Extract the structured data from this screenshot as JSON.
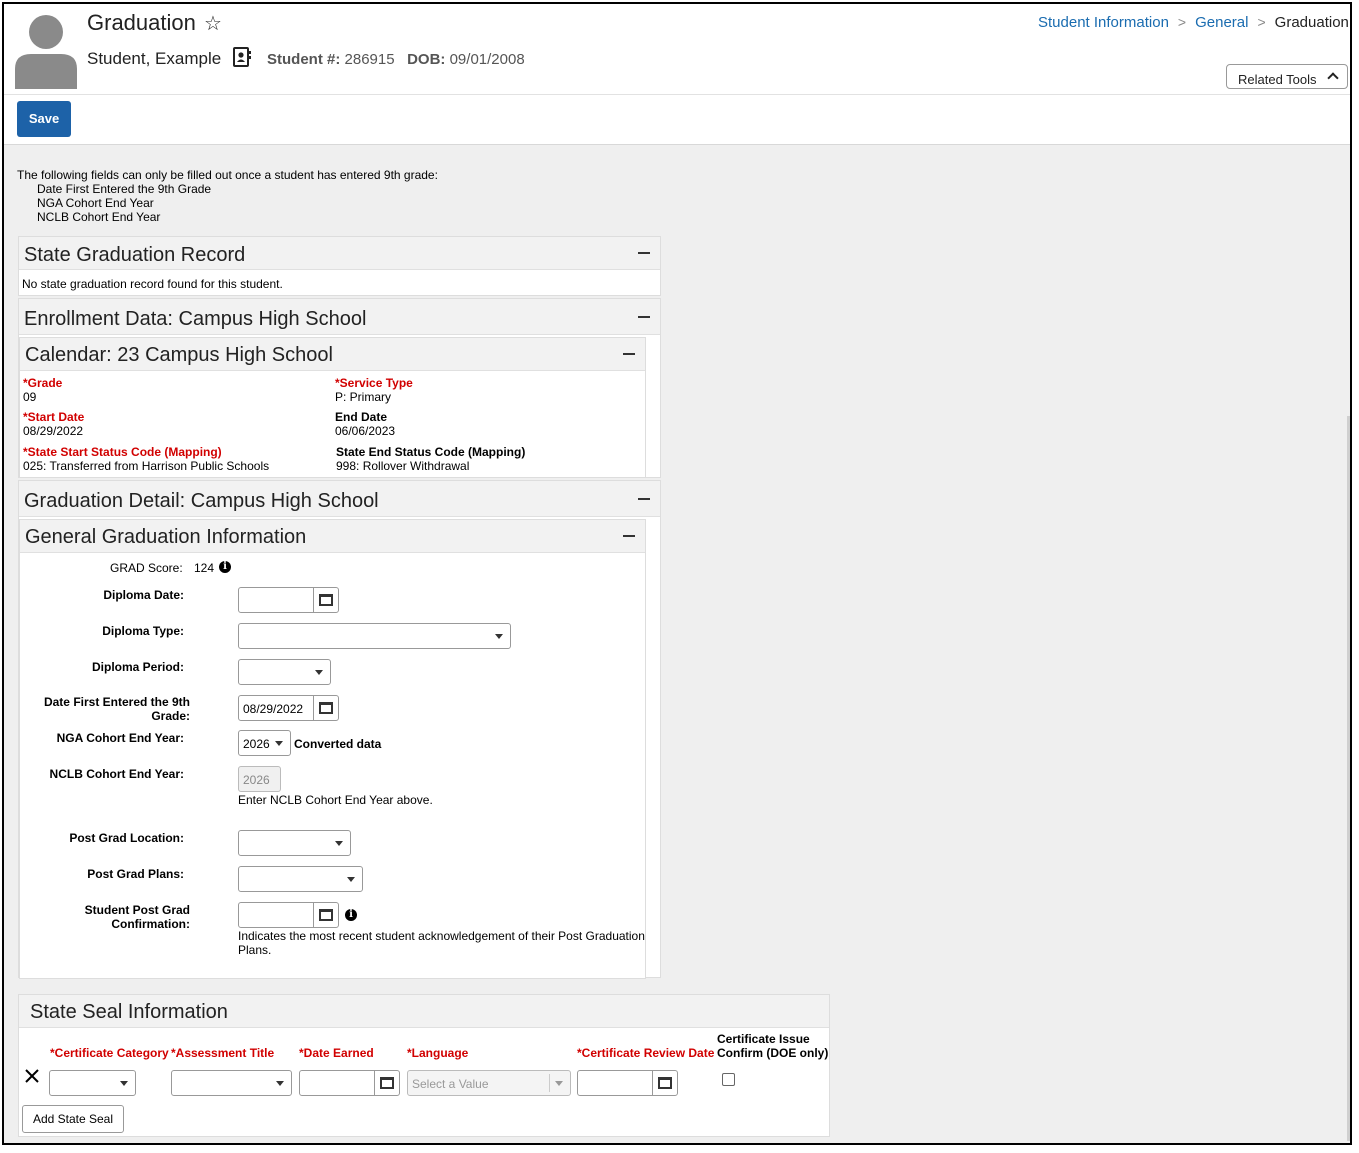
{
  "header": {
    "title": "Graduation",
    "student_name": "Student, Example",
    "student_num_label": "Student #:",
    "student_num": "286915",
    "dob_label": "DOB:",
    "dob": "09/01/2008"
  },
  "breadcrumb": [
    "Student Information",
    "General",
    "Graduation"
  ],
  "related_tools": "Related Tools",
  "toolbar": {
    "save": "Save"
  },
  "notice": {
    "intro": "The following fields can only be filled out once a student has entered 9th grade:",
    "items": [
      "Date First Entered the 9th Grade",
      "NGA Cohort End Year",
      "NCLB Cohort End Year"
    ]
  },
  "state_grad": {
    "title": "State Graduation Record",
    "message": "No state graduation record found for this student."
  },
  "enrollment": {
    "title": "Enrollment Data: Campus High School",
    "calendar": {
      "title": "Calendar: 23 Campus High School",
      "grade_label": "Grade",
      "grade": "09",
      "service_label": "Service Type",
      "service": "P: Primary",
      "start_label": "Start Date",
      "start": "08/29/2022",
      "end_label": "End Date",
      "end": "06/06/2023",
      "start_status_label": "State Start Status Code (Mapping)",
      "start_status": "025: Transferred from Harrison Public Schools",
      "end_status_label": "State End Status Code (Mapping)",
      "end_status": "998: Rollover Withdrawal"
    }
  },
  "grad_detail": {
    "title": "Graduation Detail: Campus High School",
    "general": {
      "title": "General Graduation Information",
      "grad_score_label": "GRAD Score:",
      "grad_score": "124",
      "diploma_date_label": "Diploma Date:",
      "diploma_type_label": "Diploma Type:",
      "diploma_period_label": "Diploma Period:",
      "first9_label_1": "Date First Entered the 9th",
      "first9_label_2": "Grade:",
      "first9_value": "08/29/2022",
      "nga_label": "NGA Cohort End Year:",
      "nga_value": "2026",
      "nga_note": "Converted data",
      "nclb_label": "NCLB Cohort End Year:",
      "nclb_value": "2026",
      "nclb_note": "Enter NCLB Cohort End Year above.",
      "pg_location_label": "Post Grad Location:",
      "pg_plans_label": "Post Grad Plans:",
      "pg_confirm_label_1": "Student Post Grad",
      "pg_confirm_label_2": "Confirmation:",
      "pg_confirm_note_1": "Indicates the most recent student acknowledgement of their Post Graduation",
      "pg_confirm_note_2": "Plans."
    }
  },
  "state_seal": {
    "title": "State Seal Information",
    "columns": [
      "Certificate Category",
      "Assessment Title",
      "Date Earned",
      "Language",
      "Certificate Review Date"
    ],
    "confirm_label_1": "Certificate Issue",
    "confirm_label_2": "Confirm (DOE only)",
    "language_placeholder": "Select a Value",
    "add_button": "Add State Seal"
  },
  "icons": {
    "star": "star-icon",
    "card": "contact-card-icon",
    "calendar": "calendar-icon",
    "info": "info-icon",
    "remove": "remove-x-icon",
    "avatar": "avatar-icon"
  },
  "colors": {
    "accent": "#1d62a8",
    "required": "#d10000",
    "link": "#1a6cb0"
  }
}
